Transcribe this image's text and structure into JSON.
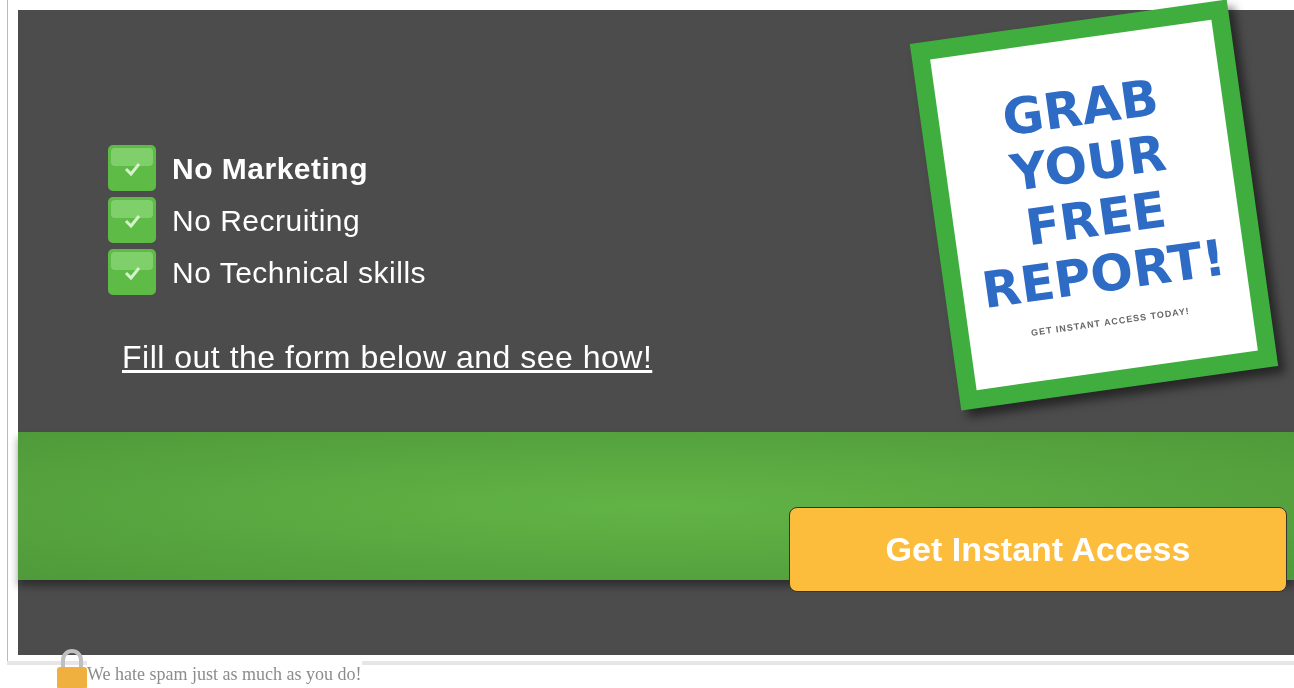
{
  "benefits": [
    {
      "label": "No Marketing",
      "bold": true
    },
    {
      "label": "No Recruiting",
      "bold": false
    },
    {
      "label": "No Technical skills",
      "bold": false
    }
  ],
  "call_to_action": "Fill out the form below and see how!",
  "report": {
    "title_lines": [
      "GRAB",
      "YOUR",
      "FREE",
      "REPORT!"
    ],
    "tagline": "GET INSTANT ACCESS TODAY!"
  },
  "submit_button": "Get Instant Access",
  "privacy_note": "We hate spam just as much as you do!"
}
